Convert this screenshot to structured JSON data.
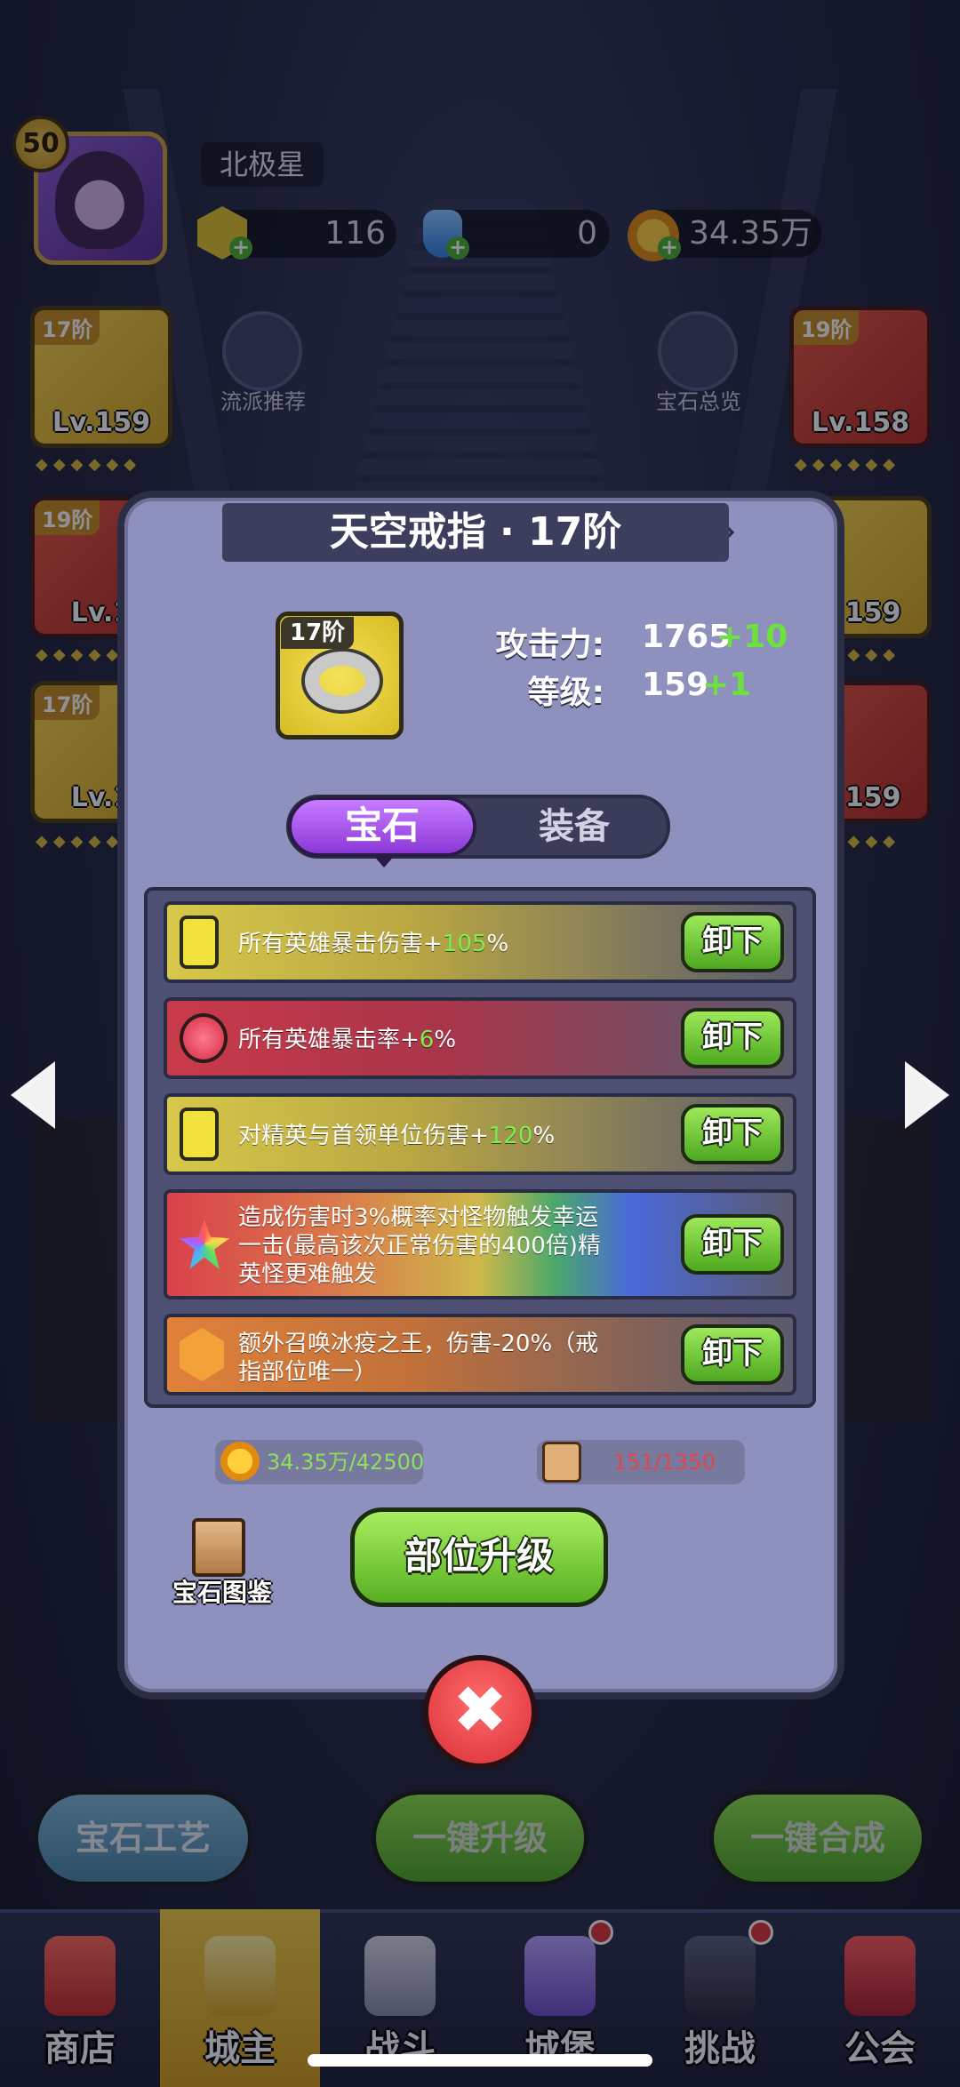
{
  "player": {
    "level": "50",
    "name": "北极星",
    "gems": "116",
    "potions": "0",
    "gold": "34.35万"
  },
  "background": {
    "slots_left": [
      {
        "tier": "17阶",
        "level": "Lv.159"
      },
      {
        "tier": "19阶",
        "level": "Lv.1"
      },
      {
        "tier": "17阶",
        "level": "Lv.1"
      }
    ],
    "slots_right": [
      {
        "tier": "19阶",
        "level": "Lv.158"
      },
      {
        "tier": "",
        "level": "v.159"
      },
      {
        "tier": "",
        "level": "v.159"
      }
    ],
    "side_buttons": {
      "recommend": "流派推荐",
      "overview": "宝石总览"
    },
    "bottom_buttons": {
      "craft": "宝石工艺",
      "upgrade_all": "一键升级",
      "merge_all": "一键合成"
    }
  },
  "nav": {
    "items": [
      {
        "label": "商店"
      },
      {
        "label": "城主"
      },
      {
        "label": "战斗"
      },
      {
        "label": "城堡"
      },
      {
        "label": "挑战"
      },
      {
        "label": "公会"
      }
    ]
  },
  "panel": {
    "title": "天空戒指 · 17阶",
    "item_tier": "17阶",
    "stats": {
      "attack_label": "攻击力:",
      "attack_value": "1765",
      "attack_inc": "+10",
      "level_label": "等级:",
      "level_value": "159",
      "level_inc": "+1"
    },
    "tabs": {
      "gem": "宝石",
      "equip": "装备"
    },
    "gems": [
      {
        "pre": "所有英雄暴击伤害+",
        "hl": "105",
        "post": "%",
        "button": "卸下"
      },
      {
        "pre": "所有英雄暴击率+",
        "hl": "6",
        "post": "%",
        "button": "卸下"
      },
      {
        "pre": "对精英与首领单位伤害+",
        "hl": "120",
        "post": "%",
        "button": "卸下"
      },
      {
        "pre": "造成伤害时3%概率对怪物触发幸运一击(最高该次正常伤害的400倍)精英怪更难触发",
        "hl": "",
        "post": "",
        "button": "卸下"
      },
      {
        "pre": "额外召唤冰疫之王，伤害-20%（戒指部位唯一）",
        "hl": "",
        "post": "",
        "button": "卸下"
      }
    ],
    "cost_gold": "34.35万/42500",
    "cost_scroll": "151/1350",
    "codex_label": "宝石图鉴",
    "upgrade_label": "部位升级",
    "colors": {
      "panel_bg": "#8e90bd",
      "highlight_green": "#7cf04a",
      "cost_red": "#e0474c",
      "cost_green": "#8ee05a"
    }
  }
}
